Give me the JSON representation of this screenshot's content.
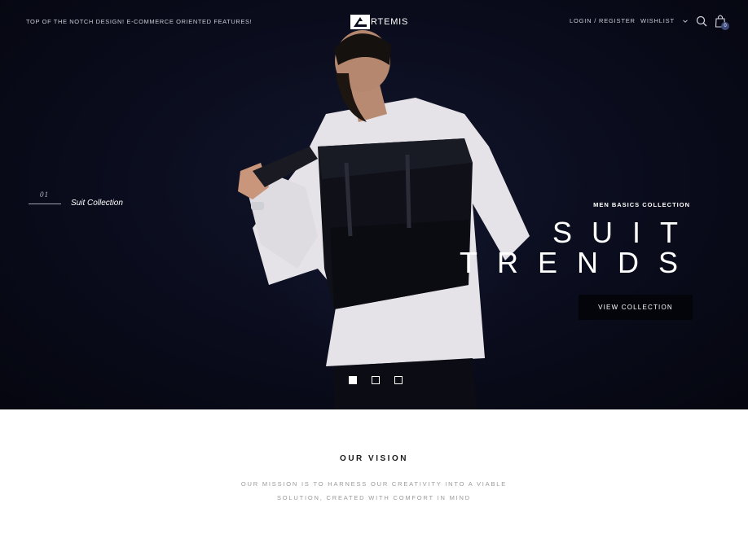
{
  "header": {
    "tagline": "TOP OF THE NOTCH DESIGN! E-COMMERCE ORIENTED FEATURES!",
    "logo_text": "RTEMIS",
    "nav": {
      "login": "LOGIN / REGISTER",
      "wishlist": "WISHLIST"
    },
    "icons": {
      "search": "search-icon",
      "cart": "shopping-bag-icon",
      "wishlist_dropdown": "chevron-down-icon"
    },
    "cart_count": "0"
  },
  "hero": {
    "slide_number": "01",
    "slide_title": "Suit Collection",
    "kicker": "MEN BASICS COLLECTION",
    "headline_line1": "SUIT",
    "headline_line2": "TRENDS",
    "cta_label": "VIEW COLLECTION",
    "slides_total": 3,
    "active_slide": 1
  },
  "vision": {
    "title": "OUR VISION",
    "line1": "OUR MISSION IS TO HARNESS OUR CREATIVITY INTO A VIABLE",
    "line2": "SOLUTION, CREATED WITH COMFORT IN MIND"
  },
  "colors": {
    "hero_background": "#0a0c1c",
    "button_background": "#04050b",
    "cart_badge": "#3d4a7a",
    "text_light": "#ffffff",
    "text_muted": "#9a9a9a"
  }
}
